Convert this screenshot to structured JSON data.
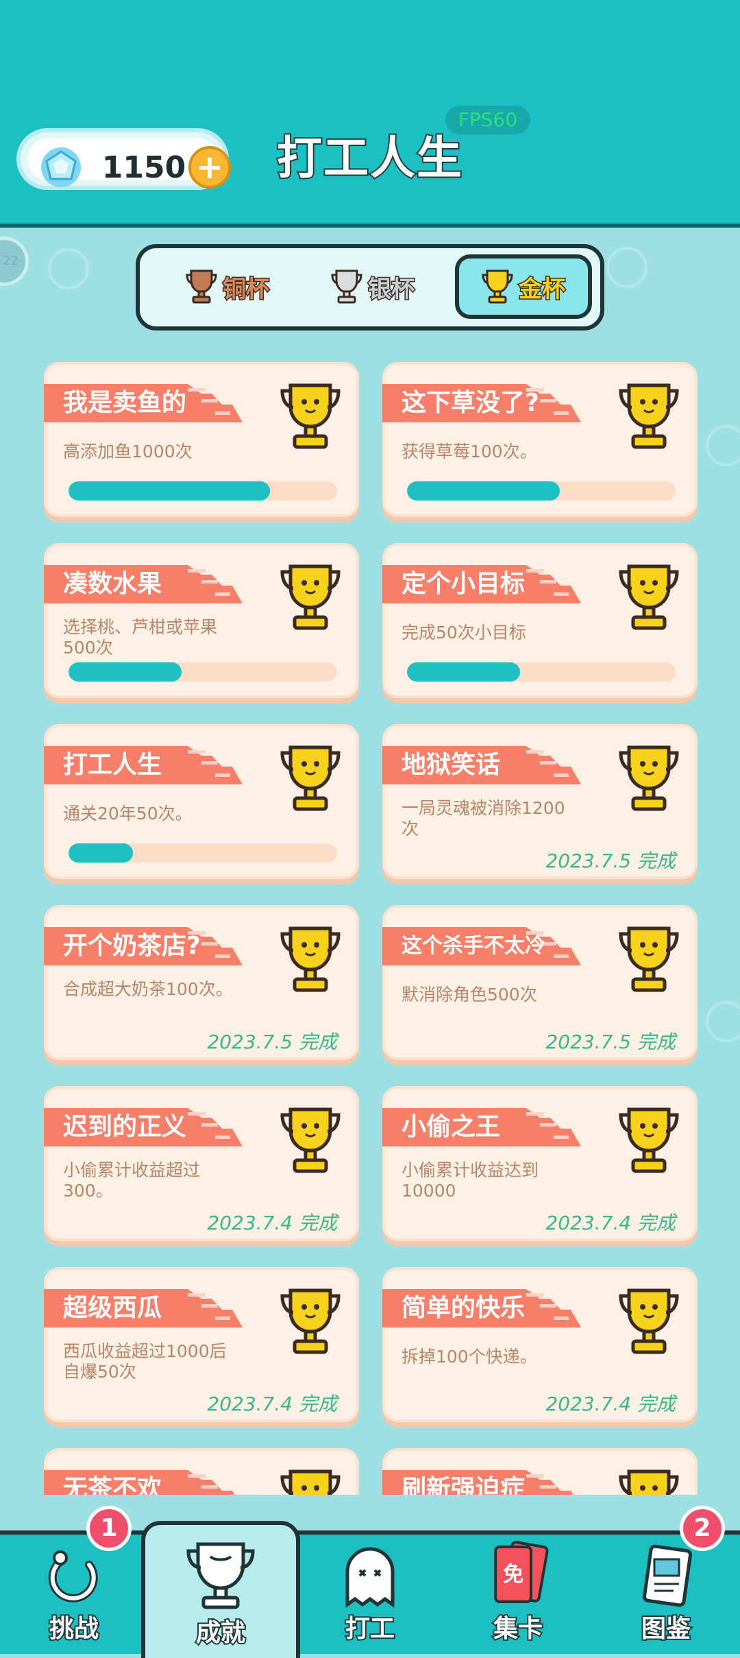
{
  "header": {
    "fps": "FPS60",
    "title": "打工人生",
    "gems": "1150",
    "plus": "+",
    "side_badge": "22"
  },
  "tabs": [
    {
      "label": "铜杯",
      "icon": "bronze-trophy-icon",
      "active": false
    },
    {
      "label": "银杯",
      "icon": "silver-trophy-icon",
      "active": false
    },
    {
      "label": "金杯",
      "icon": "gold-trophy-icon",
      "active": true
    }
  ],
  "cards": [
    {
      "title": "我是卖鱼的",
      "desc": "高添加鱼1000次",
      "progress": 0.75,
      "done": ""
    },
    {
      "title": "这下草没了?",
      "desc": "获得草莓100次。",
      "progress": 0.57,
      "done": ""
    },
    {
      "title": "凑数水果",
      "desc": "选择桃、芦柑或苹果500次",
      "progress": 0.42,
      "done": ""
    },
    {
      "title": "定个小目标",
      "desc": "完成50次小目标",
      "progress": 0.42,
      "done": ""
    },
    {
      "title": "打工人生",
      "desc": "通关20年50次。",
      "progress": 0.24,
      "done": ""
    },
    {
      "title": "地狱笑话",
      "desc": "一局灵魂被消除1200次",
      "progress": null,
      "done": "2023.7.5 完成"
    },
    {
      "title": "开个奶茶店?",
      "desc": "合成超大奶茶100次。",
      "progress": null,
      "done": "2023.7.5 完成"
    },
    {
      "title": "这个杀手不太冷",
      "desc": "默消除角色500次",
      "progress": null,
      "done": "2023.7.5 完成"
    },
    {
      "title": "迟到的正义",
      "desc": "小偷累计收益超过300。",
      "progress": null,
      "done": "2023.7.4 完成"
    },
    {
      "title": "小偷之王",
      "desc": "小偷累计收益达到10000",
      "progress": null,
      "done": "2023.7.4 完成"
    },
    {
      "title": "超级西瓜",
      "desc": "西瓜收益超过1000后自爆50次",
      "progress": null,
      "done": "2023.7.4 完成"
    },
    {
      "title": "简单的快乐",
      "desc": "拆掉100个快递。",
      "progress": null,
      "done": "2023.7.4 完成"
    },
    {
      "title": "无茶不欢",
      "desc": "",
      "progress": null,
      "done": ""
    },
    {
      "title": "刷新强迫症",
      "desc": "",
      "progress": null,
      "done": ""
    }
  ],
  "nav": [
    {
      "label": "挑战",
      "icon": "challenge-icon",
      "badge": "1",
      "active": false
    },
    {
      "label": "成就",
      "icon": "trophy-icon",
      "badge": "",
      "active": true
    },
    {
      "label": "打工",
      "icon": "ghost-icon",
      "badge": "",
      "active": false
    },
    {
      "label": "集卡",
      "icon": "card-icon",
      "badge": "",
      "active": false
    },
    {
      "label": "图鉴",
      "icon": "book-icon",
      "badge": "2",
      "active": false
    }
  ],
  "colors": {
    "teal": "#1cc0c2",
    "card_bg": "#fdf0e4",
    "ribbon": "#f77f6a",
    "progress": "#1fbfc3",
    "done_text": "#3bb58c"
  }
}
